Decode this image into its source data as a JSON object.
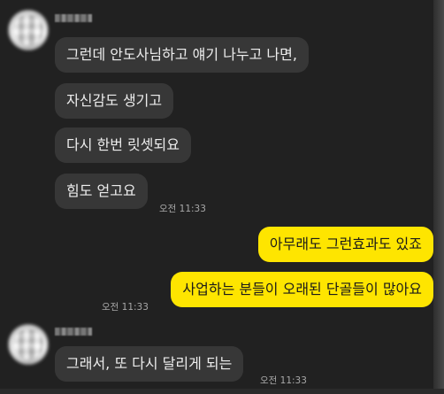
{
  "messages": [
    {
      "side": "incoming",
      "text": "그런데 안도사님하고 얘기 나누고 나면,"
    },
    {
      "side": "incoming",
      "text": "자신감도 생기고"
    },
    {
      "side": "incoming",
      "text": "다시 한번 릿셋되요"
    },
    {
      "side": "incoming",
      "text": "힘도 얻고요",
      "time": "오전 11:33"
    },
    {
      "side": "outgoing",
      "text": "아무래도 그런효과도 있죠"
    },
    {
      "side": "outgoing",
      "text": "사업하는 분들이 오래된 단골들이 많아요",
      "time": "오전 11:33"
    },
    {
      "side": "incoming",
      "text": "그래서, 또 다시 달리게 되는",
      "time": "오전 11:33"
    }
  ],
  "colors": {
    "background": "#212121",
    "incoming_bubble": "#373737",
    "outgoing_bubble": "#fee500",
    "timestamp": "#a8a8a8"
  },
  "icons": {
    "avatar": "blurred-profile-avatar",
    "sender_name": "blurred-sender-name"
  }
}
